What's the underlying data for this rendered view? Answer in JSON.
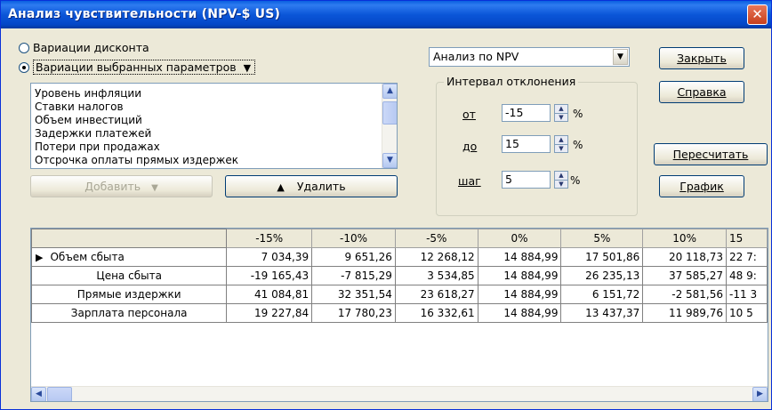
{
  "window": {
    "title": "Анализ чувствительности (NPV-$ US)",
    "close_glyph": "✕"
  },
  "mode": {
    "option_discount": "Вариации дисконта",
    "option_params": "Вариации выбранных параметров",
    "selected": "option_params"
  },
  "params_list": [
    "Уровень инфляции",
    "Ставки налогов",
    "Объем инвестиций",
    "Задержки платежей",
    "Потери при продажах",
    "Отсрочка оплаты прямых издержек"
  ],
  "buttons": {
    "add": "Добавить",
    "remove": "Удалить",
    "close": "Закрыть",
    "help": "Справка",
    "recalc": "Пересчитать",
    "chart": "График"
  },
  "analysis_select": {
    "value": "Анализ по NPV"
  },
  "interval": {
    "legend": "Интервал отклонения",
    "from_label": "от",
    "from_value": "-15",
    "to_label": "до",
    "to_value": "15",
    "step_label": "шаг",
    "step_value": "5",
    "unit": "%"
  },
  "table": {
    "columns": [
      "-15%",
      "-10%",
      "-5%",
      "0%",
      "5%",
      "10%",
      "15"
    ],
    "current_row_marker": "▶",
    "rows": [
      {
        "label": "Объем сбыта",
        "values": [
          "7 034,39",
          "9 651,26",
          "12 268,12",
          "14 884,99",
          "17 501,86",
          "20 118,73",
          "22 7:"
        ]
      },
      {
        "label": "Цена сбыта",
        "values": [
          "-19 165,43",
          "-7 815,29",
          "3 534,85",
          "14 884,99",
          "26 235,13",
          "37 585,27",
          "48 9:"
        ]
      },
      {
        "label": "Прямые издержки",
        "values": [
          "41 084,81",
          "32 351,54",
          "23 618,27",
          "14 884,99",
          "6 151,72",
          "-2 581,56",
          "-11 3"
        ]
      },
      {
        "label": "Зарплата персонала",
        "values": [
          "19 227,84",
          "17 780,23",
          "16 332,61",
          "14 884,99",
          "13 437,37",
          "11 989,76",
          "10 5"
        ]
      }
    ]
  },
  "colors": {
    "titlebar": "#0b56d8",
    "close": "#d9522c",
    "window_bg": "#ece9d8"
  },
  "icons": {
    "dropdown": "▼",
    "up": "▲",
    "scroll_up": "▲",
    "scroll_down": "▼",
    "scroll_left": "◀",
    "scroll_right": "▶"
  }
}
